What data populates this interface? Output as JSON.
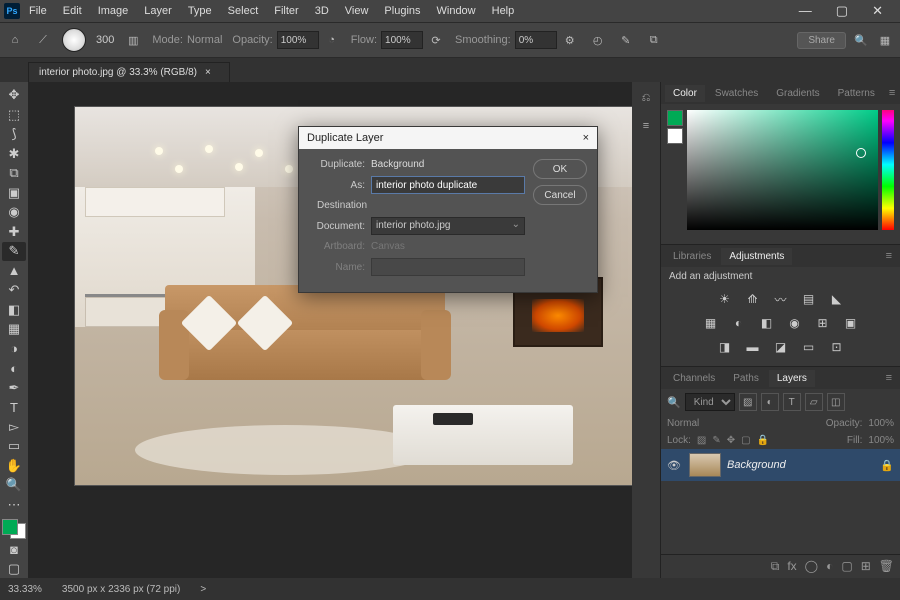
{
  "app": {
    "logo": "Ps"
  },
  "menu": [
    "File",
    "Edit",
    "Image",
    "Layer",
    "Type",
    "Select",
    "Filter",
    "3D",
    "View",
    "Plugins",
    "Window",
    "Help"
  ],
  "options": {
    "size": "300",
    "mode_lbl": "Mode:",
    "mode": "Normal",
    "opacity_lbl": "Opacity:",
    "opacity": "100%",
    "flow_lbl": "Flow:",
    "flow": "100%",
    "smooth_lbl": "Smoothing:",
    "smooth": "0%",
    "share": "Share"
  },
  "tab": {
    "title": "interior photo.jpg @ 33.3% (RGB/8)",
    "close": "×"
  },
  "dialog": {
    "title": "Duplicate Layer",
    "dup_lbl": "Duplicate:",
    "dup_val": "Background",
    "as_lbl": "As:",
    "as_val": "interior photo duplicate",
    "dest_section": "Destination",
    "doc_lbl": "Document:",
    "doc_val": "interior photo.jpg",
    "art_lbl": "Artboard:",
    "art_val": "Canvas",
    "name_lbl": "Name:",
    "name_val": "",
    "ok": "OK",
    "cancel": "Cancel",
    "close": "×"
  },
  "panels": {
    "color_tabs": [
      "Color",
      "Swatches",
      "Gradients",
      "Patterns"
    ],
    "lib_tabs": [
      "Libraries",
      "Adjustments"
    ],
    "adj_hint": "Add an adjustment",
    "layer_tabs": [
      "Channels",
      "Paths",
      "Layers"
    ],
    "kind": "Kind",
    "blend": "Normal",
    "opacity_lbl": "Opacity:",
    "opacity": "100%",
    "lock_lbl": "Lock:",
    "fill_lbl": "Fill:",
    "fill": "100%",
    "layer_name": "Background"
  },
  "status": {
    "zoom": "33.33%",
    "dims": "3500 px x 2336 px (72 ppi)",
    "arrow": ">"
  }
}
